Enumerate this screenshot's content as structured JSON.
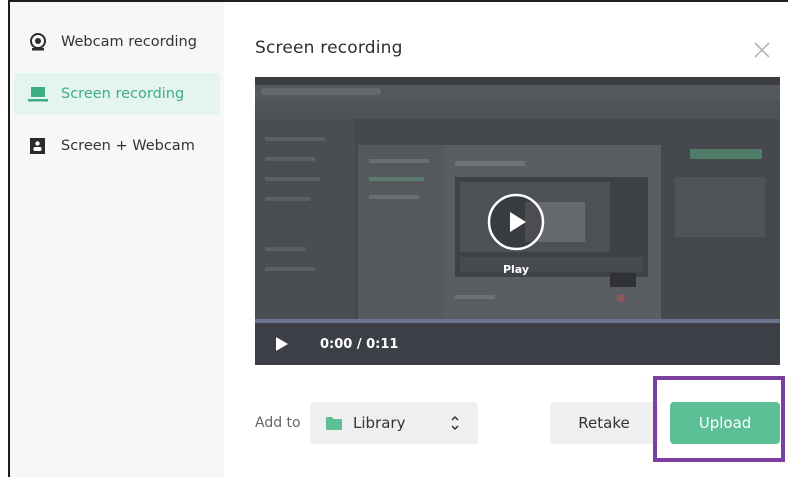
{
  "sidebar": {
    "items": [
      {
        "label": "Webcam recording",
        "icon": "webcam-icon",
        "active": false
      },
      {
        "label": "Screen recording",
        "icon": "laptop-icon",
        "active": true
      },
      {
        "label": "Screen + Webcam",
        "icon": "screen-webcam-icon",
        "active": false
      }
    ]
  },
  "modal": {
    "title": "Screen recording",
    "close_icon": "close-icon"
  },
  "player": {
    "play_label": "Play",
    "time": "0:00 / 0:11",
    "progress": 0
  },
  "footer": {
    "add_to_label": "Add to",
    "folder_select": {
      "value": "Library",
      "icon": "folder-icon"
    },
    "retake_label": "Retake",
    "upload_label": "Upload"
  },
  "colors": {
    "accent": "#5cbf95",
    "active_bg": "#e4f4ee",
    "highlight": "#7c3fa0"
  }
}
